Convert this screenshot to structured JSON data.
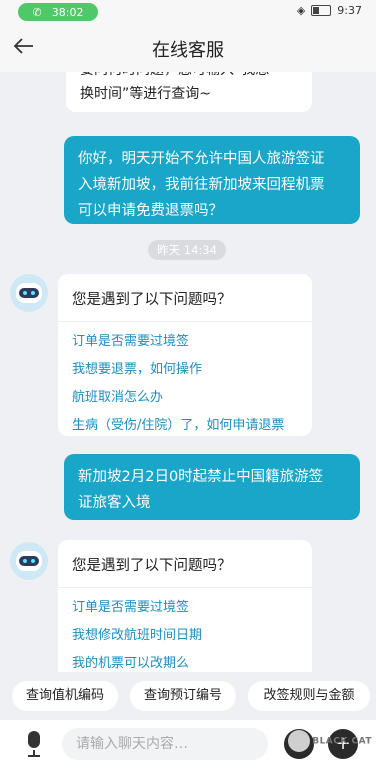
{
  "status": {
    "call_time": "38:02",
    "clock": "9:37"
  },
  "header": {
    "title": "在线客服",
    "back_icon": "back-arrow-icon"
  },
  "chat": {
    "clipped_top": {
      "line1": "要问何时问题，您可输入“我想",
      "line2": "换时间”等进行查询~"
    },
    "user_msg1": {
      "line1": "你好，明天开始不允许中国人旅游签证",
      "line2": "入境新加坡，我前往新加坡来回程机票",
      "line3": "可以申请免费退票吗？"
    },
    "timestamp": "昨天 14:34",
    "bot_reply1": {
      "title": "您是遇到了以下问题吗？",
      "links": [
        "订单是否需要过境签",
        "我想要退票，如何操作",
        "航班取消怎么办",
        "生病（受伤/住院）了，如何申请退票"
      ]
    },
    "user_msg2": {
      "line1": "新加坡2月2日0时起禁止中国籍旅游签",
      "line2": "证旅客入境"
    },
    "bot_reply2": {
      "title": "您是遇到了以下问题吗？",
      "links": [
        "订单是否需要过境签",
        "我想修改航班时间日期",
        "我的机票可以改期么"
      ]
    }
  },
  "quick_replies": [
    "查询值机编码",
    "查询预订编号",
    "改签规则与金额"
  ],
  "input": {
    "placeholder": "请输入聊天内容…"
  },
  "watermark": {
    "text": "BLACK CAT"
  }
}
